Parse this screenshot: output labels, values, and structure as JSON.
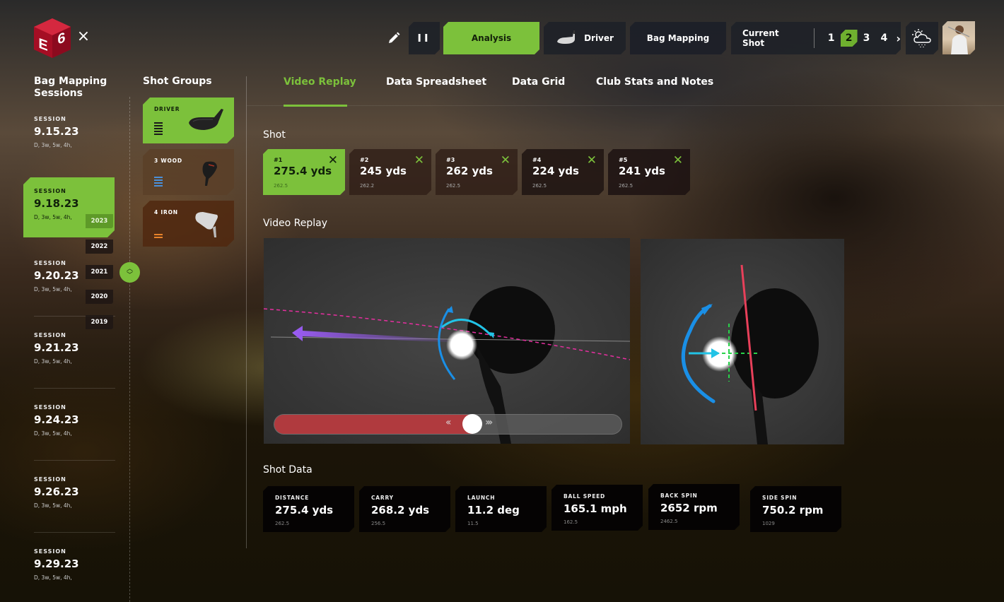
{
  "app": {
    "logo_text": "E6",
    "close_label": "×"
  },
  "topbar": {
    "pause_label": "II",
    "analysis_label": "Analysis",
    "driver_label": "Driver",
    "bag_mapping_label": "Bag Mapping",
    "current_shot_label": "Current Shot",
    "shot_numbers": [
      "1",
      "2",
      "3",
      "4"
    ],
    "active_shot_number": "2",
    "next_label": "›"
  },
  "sidebar": {
    "title": "Bag Mapping Sessions",
    "session_label": "SESSION",
    "sessions": [
      {
        "date": "9.15.23",
        "clubs": "D, 3w, 5w, 4h,"
      },
      {
        "date": "9.18.23",
        "clubs": "D, 3w, 5w, 4h,",
        "active": true
      },
      {
        "date": "9.20.23",
        "clubs": "D, 3w, 5w, 4h,"
      },
      {
        "date": "9.21.23",
        "clubs": "D, 3w, 5w, 4h,"
      },
      {
        "date": "9.24.23",
        "clubs": "D, 3w, 5w, 4h,"
      },
      {
        "date": "9.26.23",
        "clubs": "D, 3w, 5w, 4h,"
      },
      {
        "date": "9.29.23",
        "clubs": "D, 3w, 5w, 4h,"
      }
    ],
    "years": [
      "2023",
      "2022",
      "2021",
      "2020",
      "2019"
    ],
    "active_year": "2023"
  },
  "shot_groups": {
    "title": "Shot Groups",
    "groups": [
      {
        "name": "DRIVER",
        "bar_count": 5,
        "bar_color": "#1a1a1a",
        "bg": "#7cc13b",
        "active": true
      },
      {
        "name": "3 WOOD",
        "bar_count": 4,
        "bar_color": "#4a90d9",
        "bg": "rgba(90,64,40,0.85)"
      },
      {
        "name": "4 IRON",
        "bar_count": 2,
        "bar_color": "#e8832a",
        "bg": "rgba(80,40,15,0.85)"
      }
    ]
  },
  "tabs": [
    {
      "label": "Video Replay",
      "active": true
    },
    {
      "label": "Data Spreadsheet"
    },
    {
      "label": "Data Grid"
    },
    {
      "label": "Club Stats and Notes"
    }
  ],
  "shot_section": {
    "title": "Shot",
    "shots": [
      {
        "num": "#1",
        "value": "275.4 yds",
        "sub": "262.5",
        "active": true
      },
      {
        "num": "#2",
        "value": "245 yds",
        "sub": "262.2"
      },
      {
        "num": "#3",
        "value": "262 yds",
        "sub": "262.5"
      },
      {
        "num": "#4",
        "value": "224 yds",
        "sub": "262.5"
      },
      {
        "num": "#5",
        "value": "241 yds",
        "sub": "262.5"
      }
    ],
    "remove_label": "✕"
  },
  "video_section": {
    "title": "Video Replay",
    "playback_progress": 0.57,
    "rewind_label": "‹‹",
    "forward_label": "›››"
  },
  "shot_data": {
    "title": "Shot Data",
    "metrics": [
      {
        "label": "DISTANCE",
        "value": "275.4 yds",
        "sub": "262.5"
      },
      {
        "label": "CARRY",
        "value": "268.2 yds",
        "sub": "256.5"
      },
      {
        "label": "LAUNCH",
        "value": "11.2 deg",
        "sub": "11.5"
      },
      {
        "label": "BALL SPEED",
        "value": "165.1 mph",
        "sub": "162.5"
      },
      {
        "label": "BACK SPIN",
        "value": "2652 rpm",
        "sub": "2462.5"
      },
      {
        "label": "SIDE SPIN",
        "value": "750.2 rpm",
        "sub": "1029"
      }
    ]
  },
  "colors": {
    "accent": "#7cc13b",
    "scrub_fill": "#b03a3e",
    "ball_path": "#9b5cf6",
    "target_line": "#e62fa0",
    "spin_arc": "#1a8fe6",
    "face_line": "#e8405a",
    "impact_cross": "#28d24a"
  }
}
